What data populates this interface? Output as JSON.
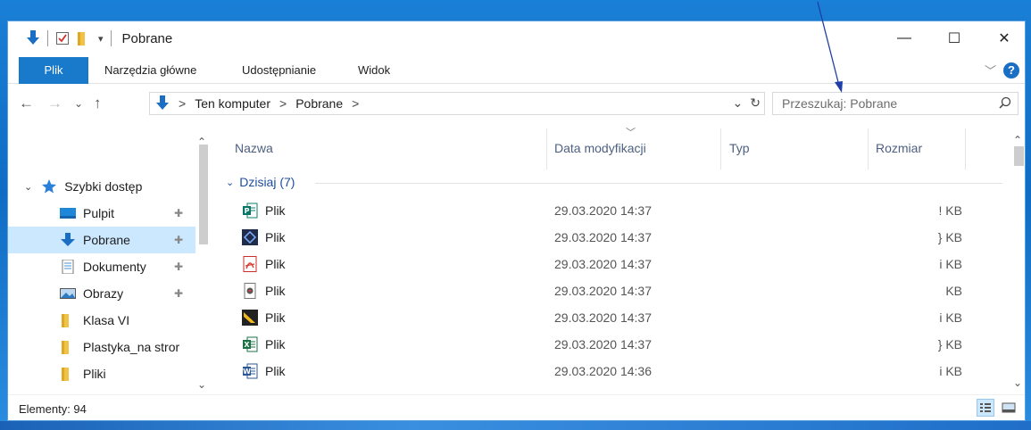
{
  "window": {
    "title": "Pobrane",
    "controls": {
      "minimize": "—",
      "maximize": "☐",
      "close": "✕"
    }
  },
  "ribbon": {
    "tabs": [
      "Plik",
      "Narzędzia główne",
      "Udostępnianie",
      "Widok"
    ],
    "help": "?"
  },
  "addressbar": {
    "crumbs": [
      "Ten komputer",
      "Pobrane"
    ],
    "separator": ">"
  },
  "search": {
    "placeholder": "Przeszukaj: Pobrane"
  },
  "navpane": {
    "quick_access": "Szybki dostęp",
    "items": [
      {
        "label": "Pulpit",
        "icon": "desktop-icon",
        "pinned": true
      },
      {
        "label": "Pobrane",
        "icon": "downloads-icon",
        "pinned": true,
        "selected": true
      },
      {
        "label": "Dokumenty",
        "icon": "documents-icon",
        "pinned": true
      },
      {
        "label": "Obrazy",
        "icon": "pictures-icon",
        "pinned": true
      },
      {
        "label": "Klasa VI",
        "icon": "folder-icon",
        "pinned": false
      },
      {
        "label": "Plastyka_na stror",
        "icon": "folder-icon",
        "pinned": false
      },
      {
        "label": "Pliki",
        "icon": "folder-icon",
        "pinned": false
      }
    ]
  },
  "columns": [
    "Nazwa",
    "Data modyfikacji",
    "Typ",
    "Rozmiar"
  ],
  "group": {
    "label": "Dzisiaj (7)"
  },
  "files": [
    {
      "name": "Plik",
      "icon": "publisher-icon",
      "date": "29.03.2020 14:37",
      "size": "! KB"
    },
    {
      "name": "Plik",
      "icon": "app-icon",
      "date": "29.03.2020 14:37",
      "size": "} KB"
    },
    {
      "name": "Plik",
      "icon": "pdf-icon",
      "date": "29.03.2020 14:37",
      "size": "i KB"
    },
    {
      "name": "Plik",
      "icon": "media-icon",
      "date": "29.03.2020 14:37",
      "size": "KB"
    },
    {
      "name": "Plik",
      "icon": "drawing-icon",
      "date": "29.03.2020 14:37",
      "size": "i KB"
    },
    {
      "name": "Plik",
      "icon": "excel-icon",
      "date": "29.03.2020 14:37",
      "size": "} KB"
    },
    {
      "name": "Plik",
      "icon": "word-icon",
      "date": "29.03.2020 14:36",
      "size": "i KB"
    }
  ],
  "status": {
    "text": "Elementy: 94"
  },
  "colors": {
    "accent": "#1979ca",
    "selection": "#cce8ff",
    "desktop": "#1a7fd6"
  }
}
